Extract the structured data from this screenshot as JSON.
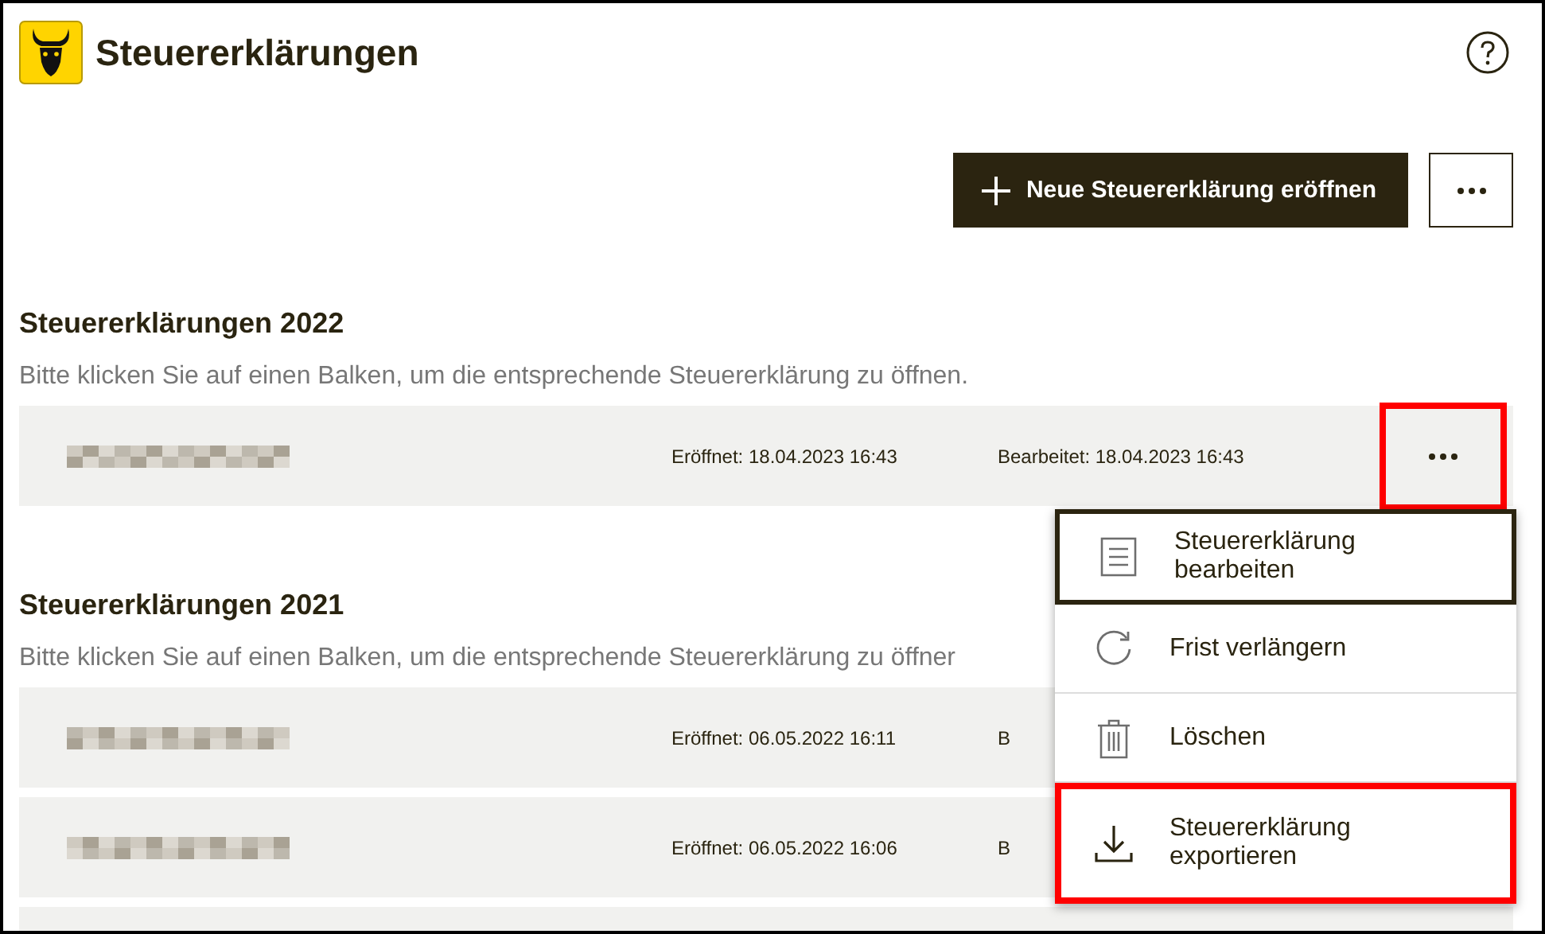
{
  "header": {
    "title": "Steuererklärungen"
  },
  "actions": {
    "new_button": "Neue Steuererklärung eröffnen"
  },
  "sections": [
    {
      "title": "Steuererklärungen 2022",
      "hint": "Bitte klicken Sie auf einen Balken, um die entsprechende Steuererklärung zu öffnen.",
      "rows": [
        {
          "name_hidden": true,
          "opened": "Eröffnet: 18.04.2023 16:43",
          "edited": "Bearbeitet: 18.04.2023 16:43",
          "menu_button": {
            "highlighted": true
          }
        }
      ]
    },
    {
      "title": "Steuererklärungen 2021",
      "hint": "Bitte klicken Sie auf einen Balken, um die entsprechende Steuererklärung zu öffner",
      "rows": [
        {
          "name_hidden": true,
          "opened": "Eröffnet: 06.05.2022 16:11",
          "edited": "B"
        },
        {
          "name_hidden": true,
          "opened": "Eröffnet: 06.05.2022 16:06",
          "edited": "B"
        },
        {
          "name_hidden": false
        }
      ]
    }
  ],
  "menu": {
    "items": [
      {
        "kind": "edit",
        "label": "Steuererklärung bearbeiten",
        "focused": true,
        "highlighted": false
      },
      {
        "kind": "extend",
        "label": "Frist verlängern",
        "focused": false,
        "highlighted": false
      },
      {
        "kind": "delete",
        "label": "Löschen",
        "focused": false,
        "highlighted": false
      },
      {
        "kind": "export",
        "label": "Steuererklärung exportieren",
        "focused": false,
        "highlighted": true
      }
    ]
  }
}
